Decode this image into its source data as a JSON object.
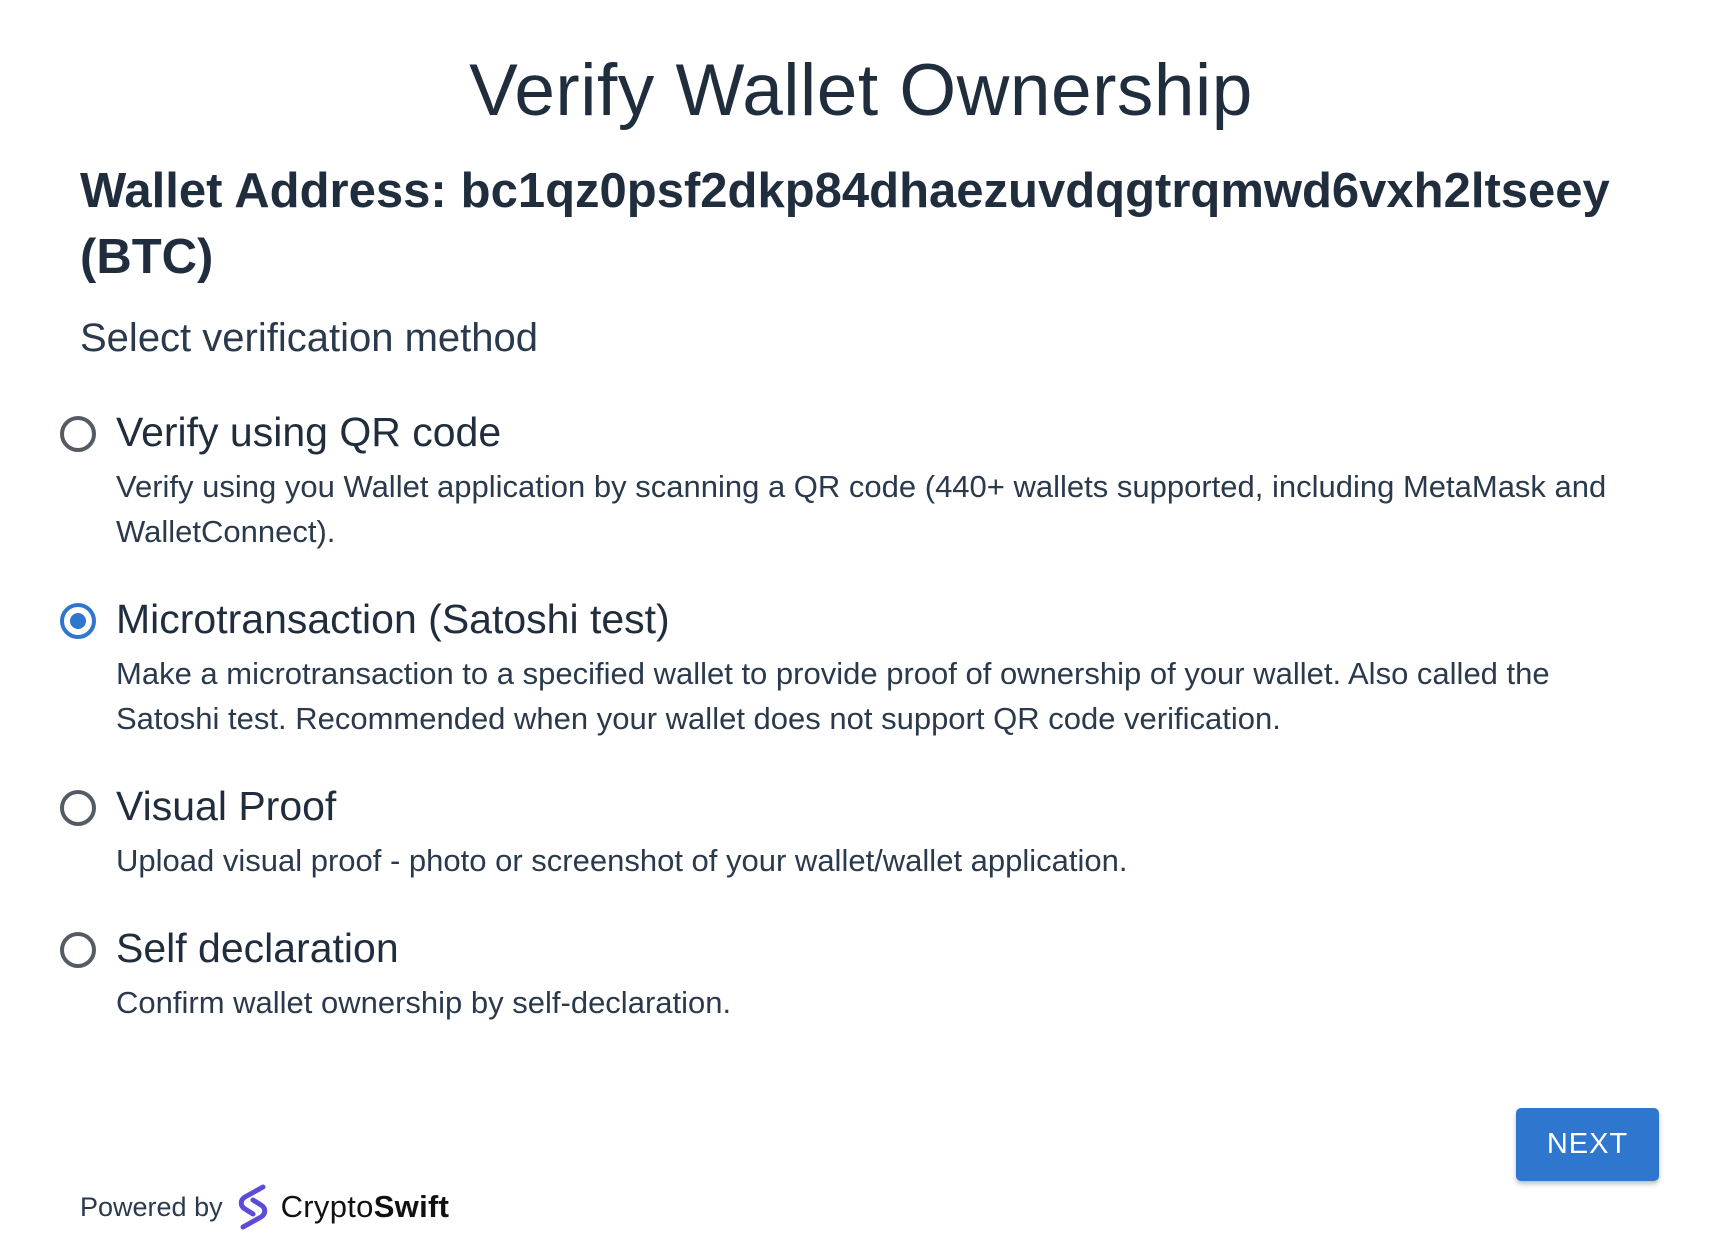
{
  "page": {
    "title": "Verify Wallet Ownership",
    "address_label": "Wallet Address:",
    "address_value": "bc1qz0psf2dkp84dhaezuvdqgtrqmwd6vxh2ltseey",
    "address_currency": "(BTC)",
    "subtitle": "Select verification method"
  },
  "options": [
    {
      "title": "Verify using QR code",
      "description": "Verify using you Wallet application by scanning a QR code (440+ wallets supported, including MetaMask and WalletConnect).",
      "selected": false
    },
    {
      "title": "Microtransaction (Satoshi test)",
      "description": "Make a microtransaction to a specified wallet to provide proof of ownership of your wallet. Also called the Satoshi test. Recommended when your wallet does not support QR code verification.",
      "selected": true
    },
    {
      "title": "Visual Proof",
      "description": "Upload visual proof - photo or screenshot of your wallet/wallet application.",
      "selected": false
    },
    {
      "title": "Self declaration",
      "description": "Confirm wallet ownership by self-declaration.",
      "selected": false
    }
  ],
  "actions": {
    "next_label": "NEXT"
  },
  "footer": {
    "powered_by": "Powered by",
    "brand_light": "Crypto",
    "brand_bold": "Swift",
    "logo_icon": "cryptoswift-logo-icon"
  },
  "colors": {
    "accent": "#2f76cf",
    "text": "#1f2d3d",
    "logo": "#5b4bdb"
  }
}
